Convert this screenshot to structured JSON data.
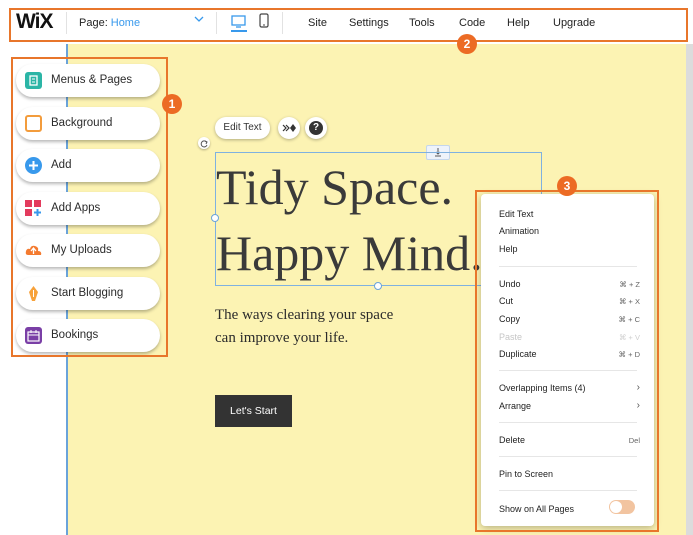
{
  "topbar": {
    "logo": "WiX",
    "page_label": "Page:",
    "page_value": "Home",
    "menu": [
      "Site",
      "Settings",
      "Tools",
      "Code",
      "Help",
      "Upgrade"
    ]
  },
  "left_panel": {
    "items": [
      {
        "label": "Menus & Pages",
        "icon": "menus-pages-icon",
        "color": "#2bb5a6"
      },
      {
        "label": "Background",
        "icon": "background-icon",
        "color": "#f39c3c"
      },
      {
        "label": "Add",
        "icon": "add-icon",
        "color": "#3899ec"
      },
      {
        "label": "Add Apps",
        "icon": "add-apps-icon",
        "color": "#e33b5d"
      },
      {
        "label": "My Uploads",
        "icon": "my-uploads-icon",
        "color": "#f47b30"
      },
      {
        "label": "Start Blogging",
        "icon": "start-blogging-icon",
        "color": "#f7a23b"
      },
      {
        "label": "Bookings",
        "icon": "bookings-icon",
        "color": "#7a3fa6"
      }
    ]
  },
  "annotations": [
    "1",
    "2",
    "3"
  ],
  "element_toolbar": {
    "edit_text": "Edit Text",
    "help": "?"
  },
  "site": {
    "title_line1": "Tidy Space.",
    "title_line2": "Happy Mind.",
    "subtitle_line1": "The ways clearing your space",
    "subtitle_line2": "can improve your life.",
    "cta": "Let's Start"
  },
  "context_menu": {
    "edit_text": "Edit Text",
    "animation": "Animation",
    "help": "Help",
    "undo": "Undo",
    "undo_sc": "⌘ + Z",
    "cut": "Cut",
    "cut_sc": "⌘ + X",
    "copy": "Copy",
    "copy_sc": "⌘ + C",
    "paste": "Paste",
    "paste_sc": "⌘ + V",
    "duplicate": "Duplicate",
    "duplicate_sc": "⌘ + D",
    "overlapping": "Overlapping Items (4)",
    "arrange": "Arrange",
    "delete": "Delete",
    "delete_sc": "Del",
    "pin": "Pin to Screen",
    "show_all": "Show on All Pages"
  },
  "colors": {
    "accent": "#e8762b",
    "canvas": "#fcf3b3",
    "wix_blue": "#3899ec"
  }
}
